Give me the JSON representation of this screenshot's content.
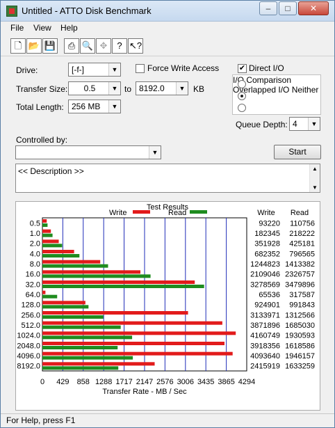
{
  "window": {
    "title": "Untitled - ATTO Disk Benchmark",
    "minimize": "–",
    "maximize": "□",
    "close": "✕"
  },
  "menu": {
    "file": "File",
    "view": "View",
    "help": "Help"
  },
  "toolbar": [
    "new-icon",
    "open-icon",
    "save-icon",
    "print-icon",
    "print-preview-icon",
    "move-icon",
    "help-icon",
    "context-help-icon"
  ],
  "settings": {
    "drive_label": "Drive:",
    "drive_value": "[-f-]",
    "force_write_label": "Force Write Access",
    "force_write_checked": false,
    "direct_io_label": "Direct I/O",
    "direct_io_checked": true,
    "transfer_size_label": "Transfer Size:",
    "transfer_from": "0.5",
    "to_label": "to",
    "transfer_to": "8192.0",
    "kb_label": "KB",
    "total_length_label": "Total Length:",
    "total_length_value": "256 MB",
    "io_options": [
      "I/O Comparison",
      "Overlapped I/O",
      "Neither"
    ],
    "io_selected": 1,
    "queue_depth_label": "Queue Depth:",
    "queue_depth_value": "4",
    "controlled_by_label": "Controlled by:",
    "controlled_by_value": "",
    "start_label": "Start",
    "description": "<< Description >>"
  },
  "status": "For Help, press F1",
  "chart_data": {
    "type": "bar",
    "title": "Test Results",
    "xlabel": "Transfer Rate - MB / Sec",
    "x_ticks": [
      "0",
      "429",
      "858",
      "1288",
      "1717",
      "2147",
      "2576",
      "3006",
      "3435",
      "3865",
      "4294"
    ],
    "xlim": [
      0,
      4294
    ],
    "categories": [
      "0.5",
      "1.0",
      "2.0",
      "4.0",
      "8.0",
      "16.0",
      "32.0",
      "64.0",
      "128.0",
      "256.0",
      "512.0",
      "1024.0",
      "2048.0",
      "4096.0",
      "8192.0"
    ],
    "series": [
      {
        "name": "Write",
        "color": "#e21b1b",
        "values": [
          91.0,
          178.1,
          343.7,
          666.4,
          1215.6,
          2059.6,
          3201.7,
          64.0,
          903.3,
          3060.5,
          3781.2,
          4063.2,
          3826.5,
          3997.7,
          2359.3
        ]
      },
      {
        "name": "Read",
        "color": "#1f8c1f",
        "values": [
          108.2,
          213.1,
          415.2,
          778.1,
          1380.3,
          2272.6,
          3398.3,
          310.1,
          968.6,
          1281.8,
          1645.5,
          1885.3,
          1580.8,
          1900.5,
          1595.0
        ]
      }
    ],
    "table_headers": {
      "write": "Write",
      "read": "Read"
    },
    "write_raw": [
      "93220",
      "182345",
      "351928",
      "682352",
      "1244823",
      "2109046",
      "3278569",
      "65536",
      "924901",
      "3133971",
      "3871896",
      "4160749",
      "3918356",
      "4093640",
      "2415919"
    ],
    "read_raw": [
      "110756",
      "218222",
      "425181",
      "796565",
      "1413382",
      "2326757",
      "3479896",
      "317587",
      "991843",
      "1312566",
      "1685030",
      "1930593",
      "1618586",
      "1946157",
      "1633259"
    ]
  }
}
